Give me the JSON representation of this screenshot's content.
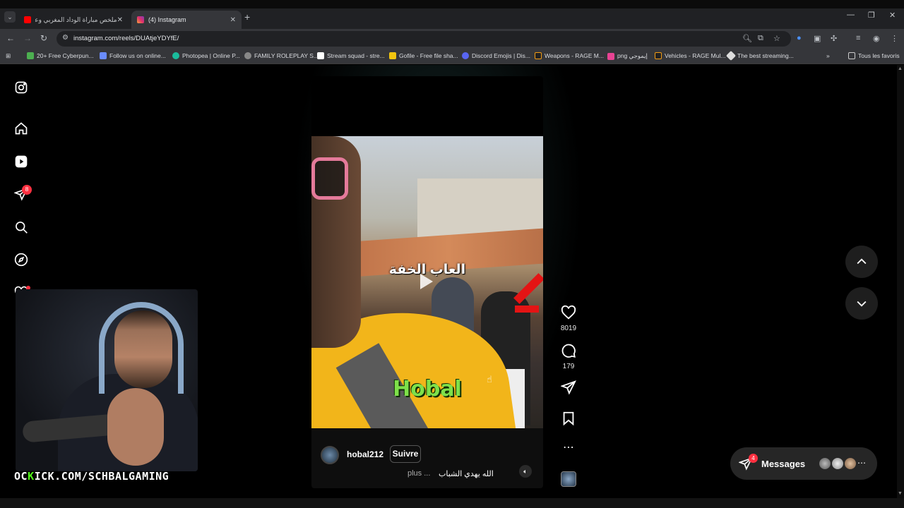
{
  "browser": {
    "tabs": [
      {
        "title": "ملخص مباراة الوداد المغربي وعزا",
        "active": false
      },
      {
        "title": "(4) Instagram",
        "active": true
      }
    ],
    "url": "instagram.com/reels/DUAtjeYDYfE/",
    "bookmarks": [
      "20+ Free Cyberpun...",
      "Follow us on online...",
      "Photopea | Online P...",
      "FAMILY ROLEPLAY S...",
      "Stream squad - stre...",
      "Gofile - Free file sha...",
      "Discord Emojis | Dis...",
      "Weapons - RAGE M...",
      "png إيموجي",
      "Vehicles - RAGE Mul...",
      "The best streaming..."
    ],
    "all_bookmarks": "Tous les favoris"
  },
  "sidebar": {
    "notifications_badge": "8"
  },
  "reel": {
    "overlay_text_arabic": "العاب الخفة",
    "overlay_text_name": "Hobal",
    "username": "hobal212",
    "follow_label": "Suivre",
    "caption": "الله يهدي الشباب",
    "more_label": "plus ..."
  },
  "actions": {
    "likes": "8019",
    "comments": "179"
  },
  "messages": {
    "label": "Messages",
    "badge": "4"
  },
  "stream": {
    "prefix": "OC",
    "kick_url": "KICK.COM/SCHBALGAMING"
  },
  "colors": {
    "accent_red": "#ff3040",
    "kick_green": "#53fc18",
    "hobal_green": "#7ee04a"
  }
}
